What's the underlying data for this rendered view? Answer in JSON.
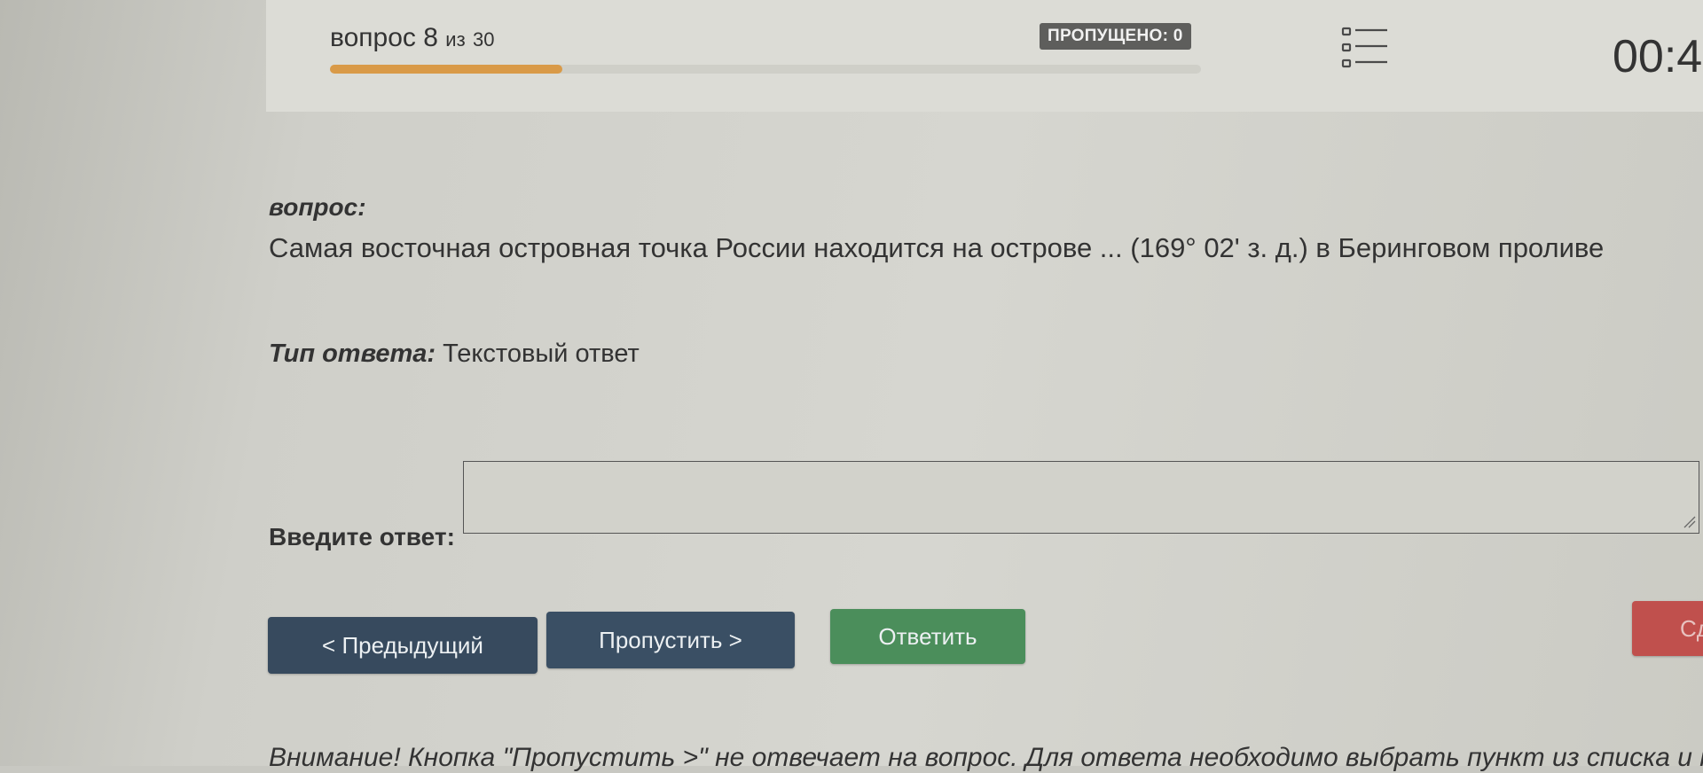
{
  "header": {
    "question_word": "вопрос",
    "question_number": "8",
    "of_word": "из",
    "total": "30",
    "progress": 0.267,
    "skipped_badge": "ПРОПУЩЕНО: 0",
    "timer": "00:4"
  },
  "question": {
    "label": "вопрос:",
    "text": "Самая восточная островная точка России находится на острове ... (169° 02' з. д.) в Беринговом проливе"
  },
  "answer_type": {
    "label": "Тип ответа:",
    "value": "Текстовый ответ"
  },
  "answer": {
    "label": "Введите ответ:",
    "value": ""
  },
  "buttons": {
    "prev": "< Предыдущий",
    "skip": "Пропустить >",
    "answer": "Ответить",
    "finish": "Сд"
  },
  "notice": "Внимание! Кнопка \"Пропустить >\" не отвечает на вопрос. Для ответа необходимо выбрать пункт из списка и н",
  "colors": {
    "progress": "#d99a48",
    "prev_button": "#374a5e",
    "answer_button": "#4b8e5b",
    "finish_button": "#c0504d"
  },
  "icons": {
    "list": "question-list-icon"
  }
}
